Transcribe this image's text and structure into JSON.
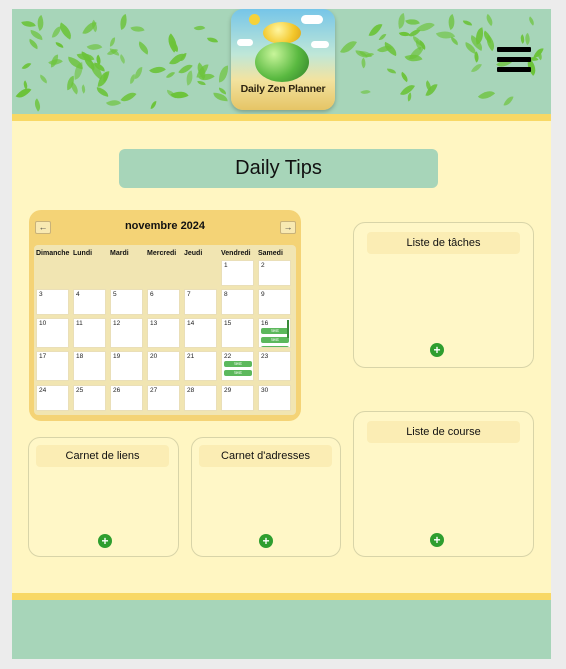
{
  "header": {
    "logo_title": "Daily Zen Planner",
    "menu_icon": "hamburger-icon",
    "leaf_color": "#6cc33a"
  },
  "page_title": "Daily Tips",
  "calendar": {
    "month_label": "novembre 2024",
    "prev_label": "←",
    "next_label": "→",
    "weekdays": [
      "Dimanche",
      "Lundi",
      "Mardi",
      "Mercredi",
      "Jeudi",
      "Vendredi",
      "Samedi"
    ],
    "weeks": [
      [
        null,
        null,
        null,
        null,
        null,
        "1",
        "2"
      ],
      [
        "3",
        "4",
        "5",
        "6",
        "7",
        "8",
        "9"
      ],
      [
        "10",
        "11",
        "12",
        "13",
        "14",
        "15",
        "16"
      ],
      [
        "17",
        "18",
        "19",
        "20",
        "21",
        "22",
        "23"
      ],
      [
        "24",
        "25",
        "26",
        "27",
        "28",
        "29",
        "30"
      ]
    ],
    "events": {
      "16": [
        "test",
        "test",
        "test"
      ],
      "22": [
        "test",
        "test"
      ]
    },
    "event_color": "#5cb85c"
  },
  "cards": {
    "tasks": {
      "title": "Liste de tâches",
      "add_label": "+"
    },
    "shopping": {
      "title": "Liste de course",
      "add_label": "+"
    },
    "links": {
      "title": "Carnet de liens",
      "add_label": "+"
    },
    "addresses": {
      "title": "Carnet d'adresses",
      "add_label": "+"
    }
  },
  "colors": {
    "page_bg": "#fff6c2",
    "header_bg": "#a7d5b9",
    "accent_yellow": "#f8d865",
    "calendar_bg": "#f4d376",
    "add_button": "#2f9e2f"
  }
}
